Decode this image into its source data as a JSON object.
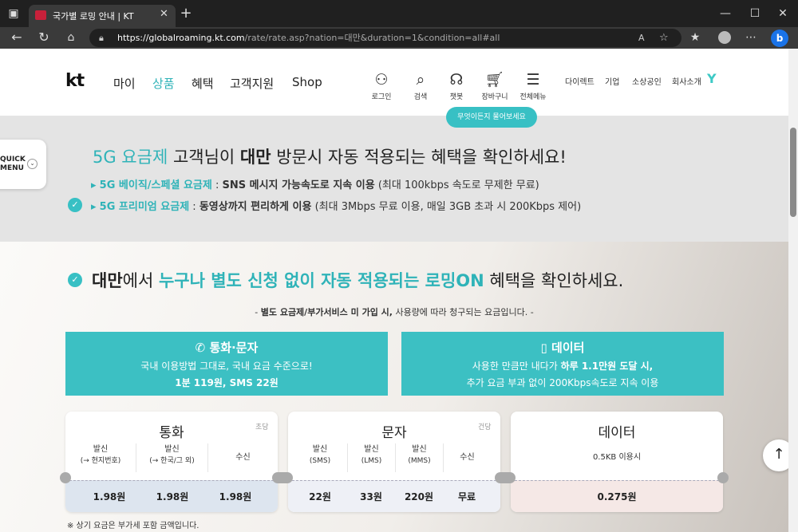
{
  "browser": {
    "tab_title": "국가별 로밍 안내 | KT",
    "url_host": "https://globalroaming.kt.com",
    "url_path": "/rate/rate.asp?nation=대만&duration=1&condition=all#all"
  },
  "header": {
    "logo": "kt",
    "nav": [
      "마이",
      "상품",
      "혜택",
      "고객지원",
      "Shop"
    ],
    "icons": [
      {
        "label": "로그인",
        "icon": "person-icon"
      },
      {
        "label": "검색",
        "icon": "search-icon"
      },
      {
        "label": "챗봇",
        "icon": "headset-icon"
      },
      {
        "label": "장바구니",
        "icon": "cart-icon"
      },
      {
        "label": "전체메뉴",
        "icon": "menu-icon"
      }
    ],
    "util": [
      "다이렉트",
      "기업",
      "소상공인",
      "회사소개"
    ],
    "chat_bubble": "무엇이든지 물어보세요"
  },
  "quick_menu": {
    "line1": "QUICK",
    "line2": "MENU"
  },
  "banner": {
    "h_part1": "5G 요금제",
    "h_part2": " 고객님이 ",
    "h_part3": "대만",
    "h_part4": " 방문시 자동 적용되는 혜택을 확인하세요!",
    "line1_label": "5G 베이직/스페셜 요금제",
    "line1_sep": " : ",
    "line1_bold": "SNS 메시지 가능속도로 지속 이용",
    "line1_rest": " (최대 100kbps 속도로 무제한 무료)",
    "line2_label": "5G 프리미엄 요금제",
    "line2_sep": " : ",
    "line2_bold": "동영상까지 편리하게 이용",
    "line2_rest": " (최대 3Mbps 무료 이용, 매일 3GB 초과 시 200Kbps 제어)"
  },
  "roaming_on": {
    "h_part1": "대만",
    "h_part2": "에서 ",
    "h_part3": "누구나 별도 신청 없이 자동 적용되는 로밍ON",
    "h_part4": " 혜택을 확인하세요.",
    "note_pre": "- ",
    "note_bold": "별도 요금제/부가서비스 미 가입 시,",
    "note_rest": " 사용량에 따라 청구되는 요금입니다. -"
  },
  "call_box": {
    "title": "통화·문자",
    "line1": "국내 이용방법 그대로, 국내 요금 수준으로!",
    "line2": "1분 119원, SMS 22원"
  },
  "data_box": {
    "title": "데이터",
    "line1_pre": "사용한 만큼만 내다가 ",
    "line1_bold": "하루 1.1만원 도달 시,",
    "line2": "추가 요금 부과 없이 200Kbps속도로 지속 이용"
  },
  "cards": {
    "call": {
      "title": "통화",
      "unit": "초당",
      "cols": [
        {
          "l1": "발신",
          "l2": "(→ 현지번호)",
          "value": "1.98원"
        },
        {
          "l1": "발신",
          "l2": "(→ 한국/그 외)",
          "value": "1.98원"
        },
        {
          "l1": "수신",
          "l2": "",
          "value": "1.98원"
        }
      ]
    },
    "msg": {
      "title": "문자",
      "unit": "건당",
      "cols": [
        {
          "l1": "발신",
          "l2": "(SMS)",
          "value": "22원"
        },
        {
          "l1": "발신",
          "l2": "(LMS)",
          "value": "33원"
        },
        {
          "l1": "발신",
          "l2": "(MMS)",
          "value": "220원"
        },
        {
          "l1": "수신",
          "l2": "",
          "value": "무료"
        }
      ]
    },
    "data": {
      "title": "데이터",
      "sub": "0.5KB 이용시",
      "value": "0.275원"
    }
  },
  "footnote": "※ 상기 요금은 부가세 포함 금액입니다."
}
